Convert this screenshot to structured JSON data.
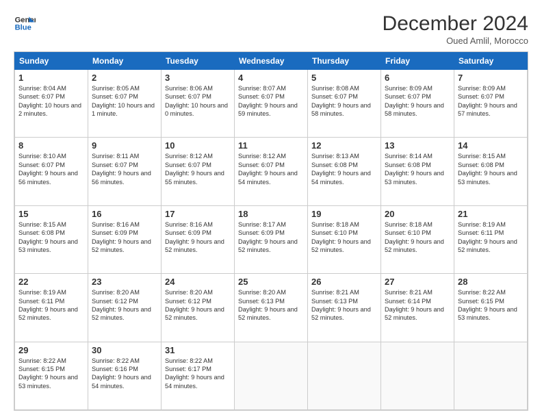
{
  "header": {
    "logo_line1": "General",
    "logo_line2": "Blue",
    "month": "December 2024",
    "location": "Oued Amlil, Morocco"
  },
  "weekdays": [
    "Sunday",
    "Monday",
    "Tuesday",
    "Wednesday",
    "Thursday",
    "Friday",
    "Saturday"
  ],
  "weeks": [
    [
      {
        "day": "1",
        "sunrise": "8:04 AM",
        "sunset": "6:07 PM",
        "daylight": "10 hours and 2 minutes."
      },
      {
        "day": "2",
        "sunrise": "8:05 AM",
        "sunset": "6:07 PM",
        "daylight": "10 hours and 1 minute."
      },
      {
        "day": "3",
        "sunrise": "8:06 AM",
        "sunset": "6:07 PM",
        "daylight": "10 hours and 0 minutes."
      },
      {
        "day": "4",
        "sunrise": "8:07 AM",
        "sunset": "6:07 PM",
        "daylight": "9 hours and 59 minutes."
      },
      {
        "day": "5",
        "sunrise": "8:08 AM",
        "sunset": "6:07 PM",
        "daylight": "9 hours and 58 minutes."
      },
      {
        "day": "6",
        "sunrise": "8:09 AM",
        "sunset": "6:07 PM",
        "daylight": "9 hours and 58 minutes."
      },
      {
        "day": "7",
        "sunrise": "8:09 AM",
        "sunset": "6:07 PM",
        "daylight": "9 hours and 57 minutes."
      }
    ],
    [
      {
        "day": "8",
        "sunrise": "8:10 AM",
        "sunset": "6:07 PM",
        "daylight": "9 hours and 56 minutes."
      },
      {
        "day": "9",
        "sunrise": "8:11 AM",
        "sunset": "6:07 PM",
        "daylight": "9 hours and 56 minutes."
      },
      {
        "day": "10",
        "sunrise": "8:12 AM",
        "sunset": "6:07 PM",
        "daylight": "9 hours and 55 minutes."
      },
      {
        "day": "11",
        "sunrise": "8:12 AM",
        "sunset": "6:07 PM",
        "daylight": "9 hours and 54 minutes."
      },
      {
        "day": "12",
        "sunrise": "8:13 AM",
        "sunset": "6:08 PM",
        "daylight": "9 hours and 54 minutes."
      },
      {
        "day": "13",
        "sunrise": "8:14 AM",
        "sunset": "6:08 PM",
        "daylight": "9 hours and 53 minutes."
      },
      {
        "day": "14",
        "sunrise": "8:15 AM",
        "sunset": "6:08 PM",
        "daylight": "9 hours and 53 minutes."
      }
    ],
    [
      {
        "day": "15",
        "sunrise": "8:15 AM",
        "sunset": "6:08 PM",
        "daylight": "9 hours and 53 minutes."
      },
      {
        "day": "16",
        "sunrise": "8:16 AM",
        "sunset": "6:09 PM",
        "daylight": "9 hours and 52 minutes."
      },
      {
        "day": "17",
        "sunrise": "8:16 AM",
        "sunset": "6:09 PM",
        "daylight": "9 hours and 52 minutes."
      },
      {
        "day": "18",
        "sunrise": "8:17 AM",
        "sunset": "6:09 PM",
        "daylight": "9 hours and 52 minutes."
      },
      {
        "day": "19",
        "sunrise": "8:18 AM",
        "sunset": "6:10 PM",
        "daylight": "9 hours and 52 minutes."
      },
      {
        "day": "20",
        "sunrise": "8:18 AM",
        "sunset": "6:10 PM",
        "daylight": "9 hours and 52 minutes."
      },
      {
        "day": "21",
        "sunrise": "8:19 AM",
        "sunset": "6:11 PM",
        "daylight": "9 hours and 52 minutes."
      }
    ],
    [
      {
        "day": "22",
        "sunrise": "8:19 AM",
        "sunset": "6:11 PM",
        "daylight": "9 hours and 52 minutes."
      },
      {
        "day": "23",
        "sunrise": "8:20 AM",
        "sunset": "6:12 PM",
        "daylight": "9 hours and 52 minutes."
      },
      {
        "day": "24",
        "sunrise": "8:20 AM",
        "sunset": "6:12 PM",
        "daylight": "9 hours and 52 minutes."
      },
      {
        "day": "25",
        "sunrise": "8:20 AM",
        "sunset": "6:13 PM",
        "daylight": "9 hours and 52 minutes."
      },
      {
        "day": "26",
        "sunrise": "8:21 AM",
        "sunset": "6:13 PM",
        "daylight": "9 hours and 52 minutes."
      },
      {
        "day": "27",
        "sunrise": "8:21 AM",
        "sunset": "6:14 PM",
        "daylight": "9 hours and 52 minutes."
      },
      {
        "day": "28",
        "sunrise": "8:22 AM",
        "sunset": "6:15 PM",
        "daylight": "9 hours and 53 minutes."
      }
    ],
    [
      {
        "day": "29",
        "sunrise": "8:22 AM",
        "sunset": "6:15 PM",
        "daylight": "9 hours and 53 minutes."
      },
      {
        "day": "30",
        "sunrise": "8:22 AM",
        "sunset": "6:16 PM",
        "daylight": "9 hours and 54 minutes."
      },
      {
        "day": "31",
        "sunrise": "8:22 AM",
        "sunset": "6:17 PM",
        "daylight": "9 hours and 54 minutes."
      },
      null,
      null,
      null,
      null
    ]
  ]
}
